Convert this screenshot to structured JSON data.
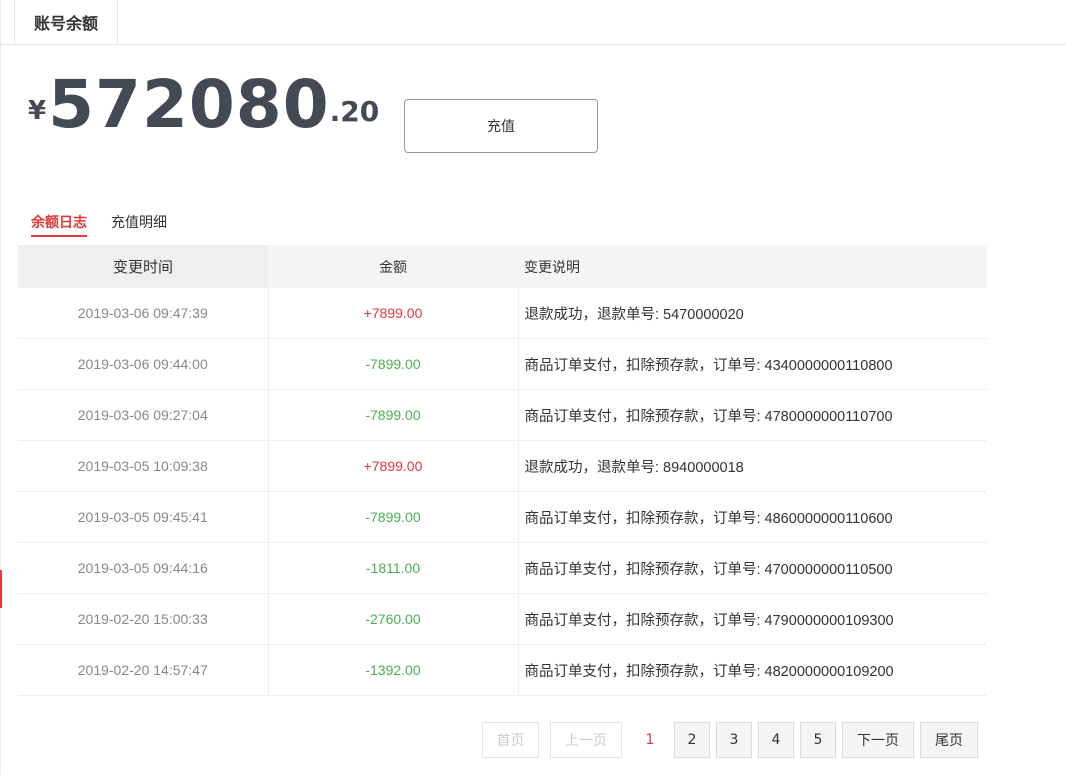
{
  "tabs": {
    "active_label": "账号余额"
  },
  "balance": {
    "currency": "¥",
    "integer": "572080",
    "decimal": ".20"
  },
  "recharge_label": "充值",
  "subtabs": [
    {
      "label": "余额日志",
      "active": true
    },
    {
      "label": "充值明细",
      "active": false
    }
  ],
  "table": {
    "headers": [
      "变更时间",
      "金额",
      "变更说明"
    ],
    "rows": [
      {
        "time": "2019-03-06 09:47:39",
        "amount": "+7899.00",
        "type": "pos",
        "desc": "退款成功，退款单号: 5470000020"
      },
      {
        "time": "2019-03-06 09:44:00",
        "amount": "-7899.00",
        "type": "neg",
        "desc": "商品订单支付，扣除预存款，订单号: 4340000000110800"
      },
      {
        "time": "2019-03-06 09:27:04",
        "amount": "-7899.00",
        "type": "neg",
        "desc": "商品订单支付，扣除预存款，订单号: 4780000000110700"
      },
      {
        "time": "2019-03-05 10:09:38",
        "amount": "+7899.00",
        "type": "pos",
        "desc": "退款成功，退款单号: 8940000018"
      },
      {
        "time": "2019-03-05 09:45:41",
        "amount": "-7899.00",
        "type": "neg",
        "desc": "商品订单支付，扣除预存款，订单号: 4860000000110600"
      },
      {
        "time": "2019-03-05 09:44:16",
        "amount": "-1811.00",
        "type": "neg",
        "desc": "商品订单支付，扣除预存款，订单号: 4700000000110500"
      },
      {
        "time": "2019-02-20 15:00:33",
        "amount": "-2760.00",
        "type": "neg",
        "desc": "商品订单支付，扣除预存款，订单号: 4790000000109300"
      },
      {
        "time": "2019-02-20 14:57:47",
        "amount": "-1392.00",
        "type": "neg",
        "desc": "商品订单支付，扣除预存款，订单号: 4820000000109200"
      }
    ]
  },
  "pagination": {
    "first": "首页",
    "prev": "上一页",
    "current": "1",
    "pages": [
      "2",
      "3",
      "4",
      "5"
    ],
    "next": "下一页",
    "last": "尾页"
  },
  "colors": {
    "accent": "#e4393c",
    "positive": "#e4393c",
    "negative": "#4caf50",
    "balance": "#434a54"
  }
}
